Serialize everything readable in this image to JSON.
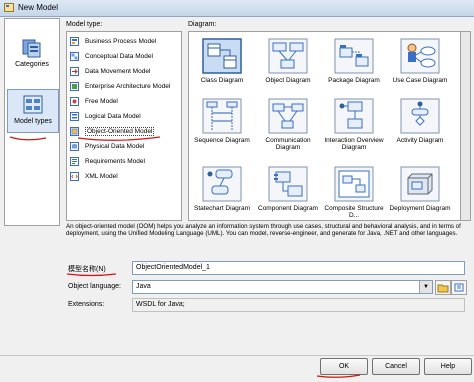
{
  "window": {
    "title": "New Model"
  },
  "categories": [
    {
      "label": "Categories",
      "icon": "categories-icon"
    },
    {
      "label": "Model types",
      "icon": "model-types-icon",
      "selected": true
    }
  ],
  "model_type_label": "Model type:",
  "diagram_label": "Diagram:",
  "model_types": [
    {
      "label": "Business Process Model",
      "icon": "business-process-model-icon"
    },
    {
      "label": "Conceptual Data Model",
      "icon": "conceptual-data-model-icon"
    },
    {
      "label": "Data Movement Model",
      "icon": "data-movement-model-icon"
    },
    {
      "label": "Enterprise Architecture Model",
      "icon": "enterprise-architecture-model-icon"
    },
    {
      "label": "Free Model",
      "icon": "free-model-icon"
    },
    {
      "label": "Logical Data Model",
      "icon": "logical-data-model-icon"
    },
    {
      "label": "Object-Oriented Model",
      "icon": "object-oriented-model-icon",
      "selected": true
    },
    {
      "label": "Physical Data Model",
      "icon": "physical-data-model-icon"
    },
    {
      "label": "Requirements Model",
      "icon": "requirements-model-icon"
    },
    {
      "label": "XML Model",
      "icon": "xml-model-icon"
    }
  ],
  "diagrams": [
    {
      "label": "Class Diagram",
      "icon": "class-diagram-icon",
      "selected": true
    },
    {
      "label": "Object Diagram",
      "icon": "object-diagram-icon"
    },
    {
      "label": "Package Diagram",
      "icon": "package-diagram-icon"
    },
    {
      "label": "Use Case Diagram",
      "icon": "use-case-diagram-icon"
    },
    {
      "label": "Sequence Diagram",
      "icon": "sequence-diagram-icon"
    },
    {
      "label": "Communication Diagram",
      "icon": "communication-diagram-icon"
    },
    {
      "label": "Interaction Overview Diagram",
      "icon": "interaction-overview-diagram-icon"
    },
    {
      "label": "Activity Diagram",
      "icon": "activity-diagram-icon"
    },
    {
      "label": "Statechart Diagram",
      "icon": "statechart-diagram-icon"
    },
    {
      "label": "Component Diagram",
      "icon": "component-diagram-icon"
    },
    {
      "label": "Composite Structure D...",
      "icon": "composite-structure-diagram-icon"
    },
    {
      "label": "Deployment Diagram",
      "icon": "deployment-diagram-icon"
    }
  ],
  "description": "An object-oriented model (OOM) helps you analyze an information system through use cases, structural and behavioral analysis, and in terms of deployment, using the Unified Modeling Language (UML). You can model, reverse-engineer, and generate for Java, .NET and other languages.",
  "form": {
    "model_name_label": "模型名称(N)",
    "model_name_value": "ObjectOrientedModel_1",
    "object_language_label": "Object language:",
    "object_language_value": "Java",
    "extensions_label": "Extensions:",
    "extensions_value": "WSDL for Java;"
  },
  "buttons": {
    "ok": "OK",
    "cancel": "Cancel",
    "help": "Help"
  }
}
